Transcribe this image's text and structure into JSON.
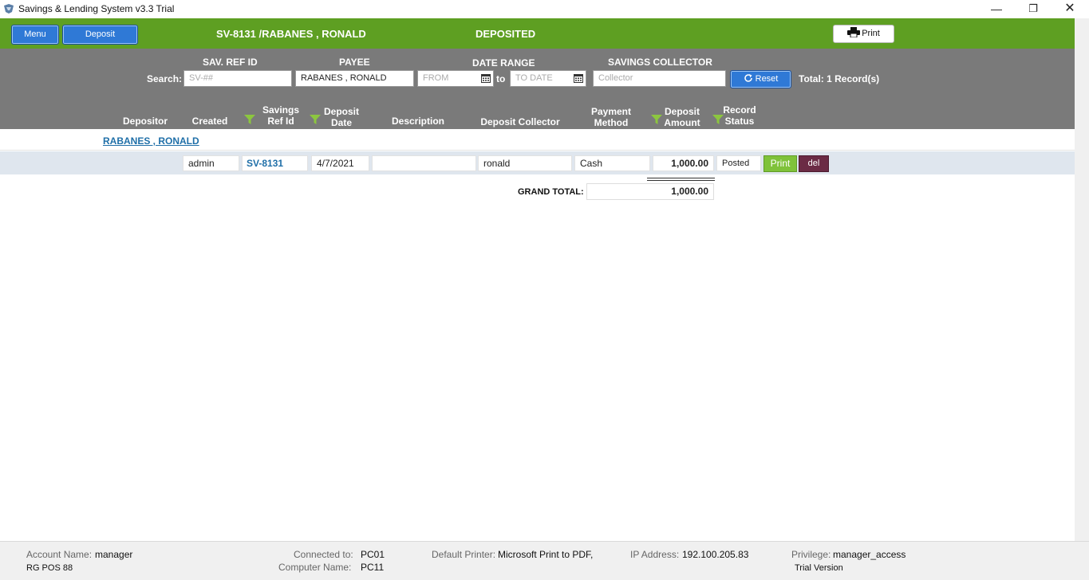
{
  "window": {
    "title": "Savings & Lending System v3.3 Trial",
    "minimize": "—",
    "maximize": "❐",
    "close": "✕"
  },
  "header": {
    "menu_label": "Menu",
    "deposit_label": "Deposit",
    "reference": "SV-8131 /RABANES , RONALD",
    "status": "DEPOSITED",
    "print_label": "Print"
  },
  "filters": {
    "search_label": "Search:",
    "sav_ref_label": "SAV. REF ID",
    "sav_ref_placeholder": "SV-##",
    "payee_label": "PAYEE",
    "payee_value": "RABANES , RONALD",
    "date_range_label": "DATE RANGE",
    "from_placeholder": "FROM",
    "to_label": "to",
    "to_placeholder": "TO DATE",
    "collector_label": "SAVINGS COLLECTOR",
    "collector_placeholder": "Collector",
    "reset_label": "Reset",
    "total_text": "Total: 1 Record(s)"
  },
  "columns": {
    "depositor": "Depositor",
    "created": "Created",
    "savings_ref_1": "Savings",
    "savings_ref_2": "Ref Id",
    "deposit_date_1": "Deposit",
    "deposit_date_2": "Date",
    "description": "Description",
    "deposit_collector": "Deposit Collector",
    "payment_method_1": "Payment",
    "payment_method_2": "Method",
    "deposit_amount_1": "Deposit",
    "deposit_amount_2": "Amount",
    "record_status_1": "Record",
    "record_status_2": "Status"
  },
  "group": {
    "name": "RABANES , RONALD"
  },
  "record": {
    "created": "admin",
    "ref_id": "SV-8131",
    "date": "4/7/2021",
    "description": "",
    "collector": "ronald",
    "payment_method": "Cash",
    "amount": "1,000.00",
    "status": "Posted",
    "print_label": "Print",
    "delete_label": "del"
  },
  "grand_total": {
    "label": "GRAND TOTAL:",
    "value": "1,000.00"
  },
  "footer": {
    "account_name_label": "Account Name:",
    "account_name": "manager",
    "pos_name": "RG POS 88",
    "connected_to_label": "Connected to:",
    "connected_to": "PC01",
    "computer_name_label": "Computer Name:",
    "computer_name": "PC11",
    "default_printer_label": "Default Printer:",
    "default_printer": "Microsoft Print to PDF,",
    "ip_label": "IP Address:",
    "ip": "192.100.205.83",
    "privilege_label": "Privilege:",
    "privilege": "manager_access",
    "version": "Trial Version"
  },
  "colors": {
    "header_green": "#5e9f22",
    "panel_gray": "#7a7a7a",
    "button_blue": "#2f79d6",
    "print_green": "#7fc23a",
    "delete_maroon": "#6b2b45",
    "link_blue": "#1f6fa8",
    "funnel_green": "#8cc63f"
  },
  "icons": {
    "app": "app-logo-icon",
    "print": "printer-icon",
    "reset": "refresh-icon",
    "calendar": "calendar-icon",
    "filter": "funnel-icon"
  }
}
